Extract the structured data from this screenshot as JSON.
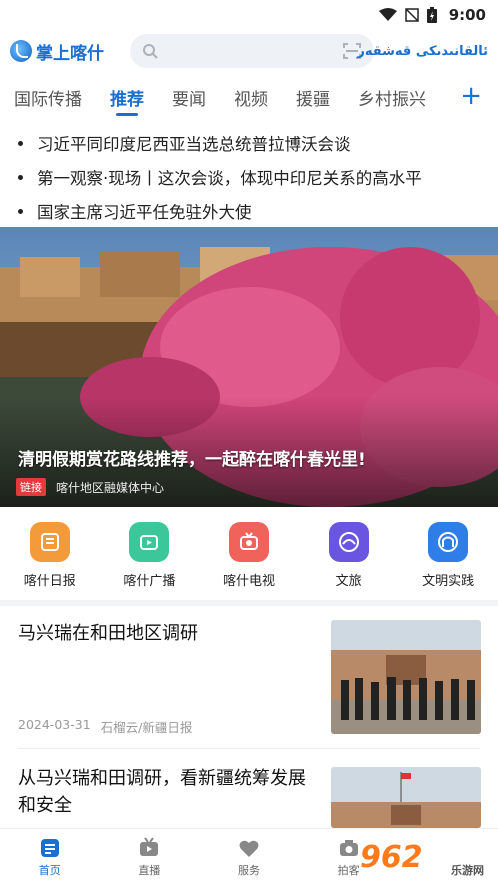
{
  "status_bar": {
    "time": "9:00"
  },
  "header": {
    "app_name": "掌上喀什",
    "uyghur_name": "ئالقانىدىكى قەشقەر"
  },
  "tabs": [
    {
      "label": "国际传播",
      "active": false
    },
    {
      "label": "推荐",
      "active": true
    },
    {
      "label": "要闻",
      "active": false
    },
    {
      "label": "视频",
      "active": false
    },
    {
      "label": "援疆",
      "active": false
    },
    {
      "label": "乡村振兴",
      "active": false
    }
  ],
  "headlines": [
    "习近平同印度尼西亚当选总统普拉博沃会谈",
    "第一观察·现场丨这次会谈，体现中印尼关系的高水平",
    "国家主席习近平任免驻外大使"
  ],
  "hero": {
    "title": "清明假期赏花路线推荐，一起醉在喀什春光里!",
    "tag": "链接",
    "source": "喀什地区融媒体中心"
  },
  "services": [
    {
      "label": "喀什日报",
      "icon": "newspaper-icon",
      "color": "#f39a3a"
    },
    {
      "label": "喀什广播",
      "icon": "radio-icon",
      "color": "#3cc79a"
    },
    {
      "label": "喀什电视",
      "icon": "tv-icon",
      "color": "#f0635a"
    },
    {
      "label": "文旅",
      "icon": "culture-tourism-icon",
      "color": "#6a55e0"
    },
    {
      "label": "文明实践",
      "icon": "civilization-practice-icon",
      "color": "#2f7ee8"
    }
  ],
  "news": [
    {
      "title": "马兴瑞在和田地区调研",
      "date": "2024-03-31",
      "source": "石榴云/新疆日报"
    },
    {
      "title": "从马兴瑞和田调研，看新疆统筹发展和安全",
      "date": "",
      "source": ""
    }
  ],
  "bottom_nav": [
    {
      "label": "首页",
      "icon": "home-icon",
      "active": true
    },
    {
      "label": "直播",
      "icon": "live-icon",
      "active": false
    },
    {
      "label": "服务",
      "icon": "service-icon",
      "active": false
    },
    {
      "label": "拍客",
      "icon": "camera-icon",
      "active": false
    }
  ],
  "watermark": {
    "brand": "962",
    "sub": "乐游网"
  },
  "colors": {
    "accent": "#1b6fd0",
    "tag_red": "#e23b3b"
  }
}
